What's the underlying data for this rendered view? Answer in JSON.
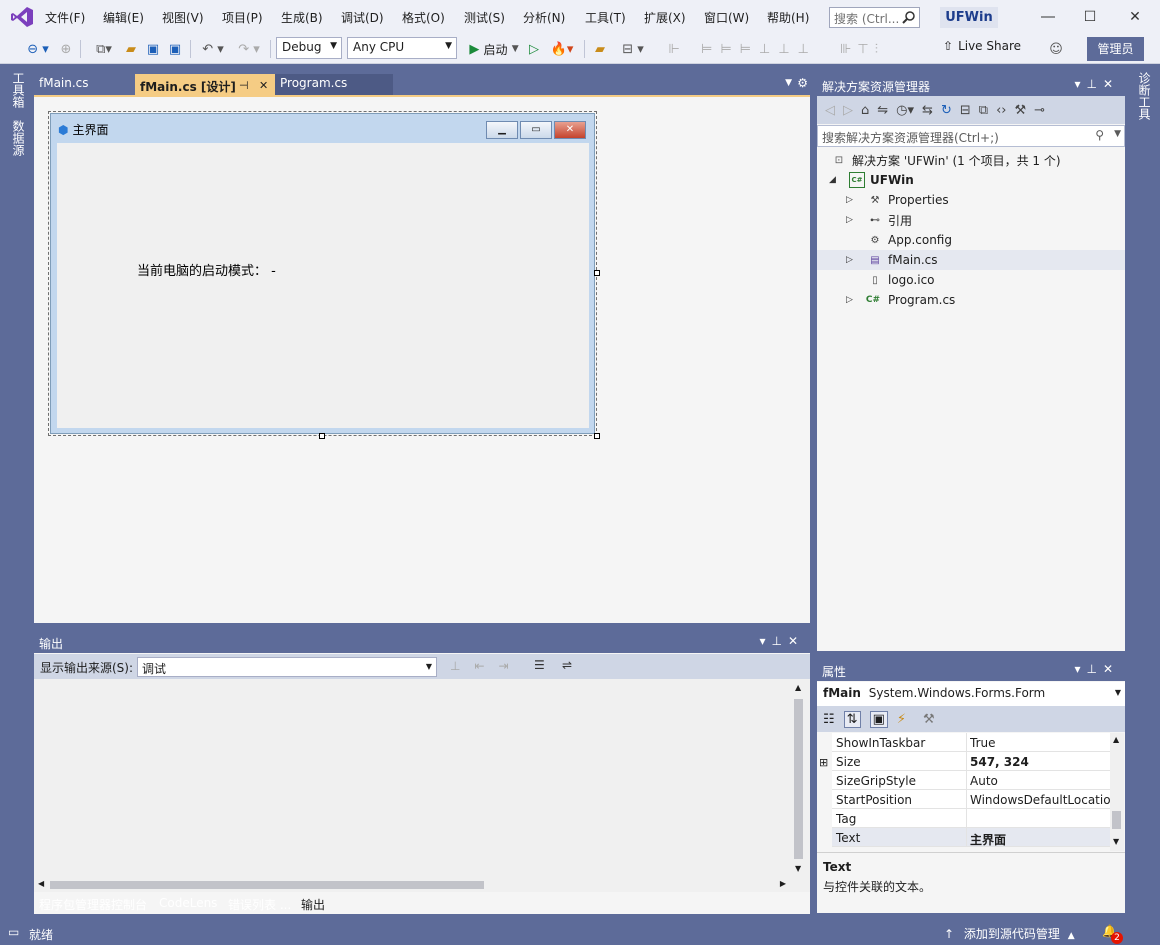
{
  "menu": [
    "文件(F)",
    "编辑(E)",
    "视图(V)",
    "项目(P)",
    "生成(B)",
    "调试(D)",
    "格式(O)",
    "测试(S)",
    "分析(N)",
    "工具(T)",
    "扩展(X)",
    "窗口(W)",
    "帮助(H)"
  ],
  "search": {
    "placeholder": "搜索 (Ctrl..."
  },
  "solution_name": "UFWin",
  "toolbar": {
    "config": "Debug",
    "platform": "Any CPU",
    "start_label": "启动",
    "live_share": "Live Share",
    "admin": "管理员"
  },
  "left_rail": [
    "工具箱",
    "数据源"
  ],
  "right_rail": [
    "诊断工具"
  ],
  "tabs": [
    {
      "label": "fMain.cs"
    },
    {
      "label": "fMain.cs [设计]",
      "pin": "⊣",
      "close": "✕"
    },
    {
      "label": "Program.cs"
    }
  ],
  "form": {
    "title": "主界面",
    "label_text": "当前电脑的启动模式：  -"
  },
  "solution_explorer": {
    "title": "解决方案资源管理器",
    "search_placeholder": "搜索解决方案资源管理器(Ctrl+;)",
    "items": [
      {
        "label": "解决方案 'UFWin' (1 个项目，共 1 个)",
        "icon": "solution-icon"
      },
      {
        "label": "UFWin",
        "icon": "csharp-project-icon"
      },
      {
        "label": "Properties",
        "icon": "wrench-icon"
      },
      {
        "label": "引用",
        "icon": "references-icon"
      },
      {
        "label": "App.config",
        "icon": "config-file-icon"
      },
      {
        "label": "fMain.cs",
        "icon": "form-file-icon"
      },
      {
        "label": "logo.ico",
        "icon": "ico-file-icon"
      },
      {
        "label": "Program.cs",
        "icon": "csharp-file-icon"
      }
    ]
  },
  "properties": {
    "title": "属性",
    "object_name": "fMain",
    "object_type": "System.Windows.Forms.Form",
    "rows": [
      {
        "name": "ShowInTaskbar",
        "value": "True"
      },
      {
        "name": "Size",
        "value": "547, 324"
      },
      {
        "name": "SizeGripStyle",
        "value": "Auto"
      },
      {
        "name": "StartPosition",
        "value": "WindowsDefaultLocatio"
      },
      {
        "name": "Tag",
        "value": ""
      },
      {
        "name": "Text",
        "value": "主界面"
      }
    ],
    "desc_title": "Text",
    "desc_text": "与控件关联的文本。"
  },
  "output": {
    "title": "输出",
    "source_label": "显示输出来源(S):",
    "source_value": "调试",
    "tabs": [
      "程序包管理器控制台",
      "CodeLens",
      "错误列表 ...",
      "输出"
    ]
  },
  "status": {
    "ready": "就绪",
    "source_control": "添加到源代码管理",
    "notification_count": "2"
  }
}
